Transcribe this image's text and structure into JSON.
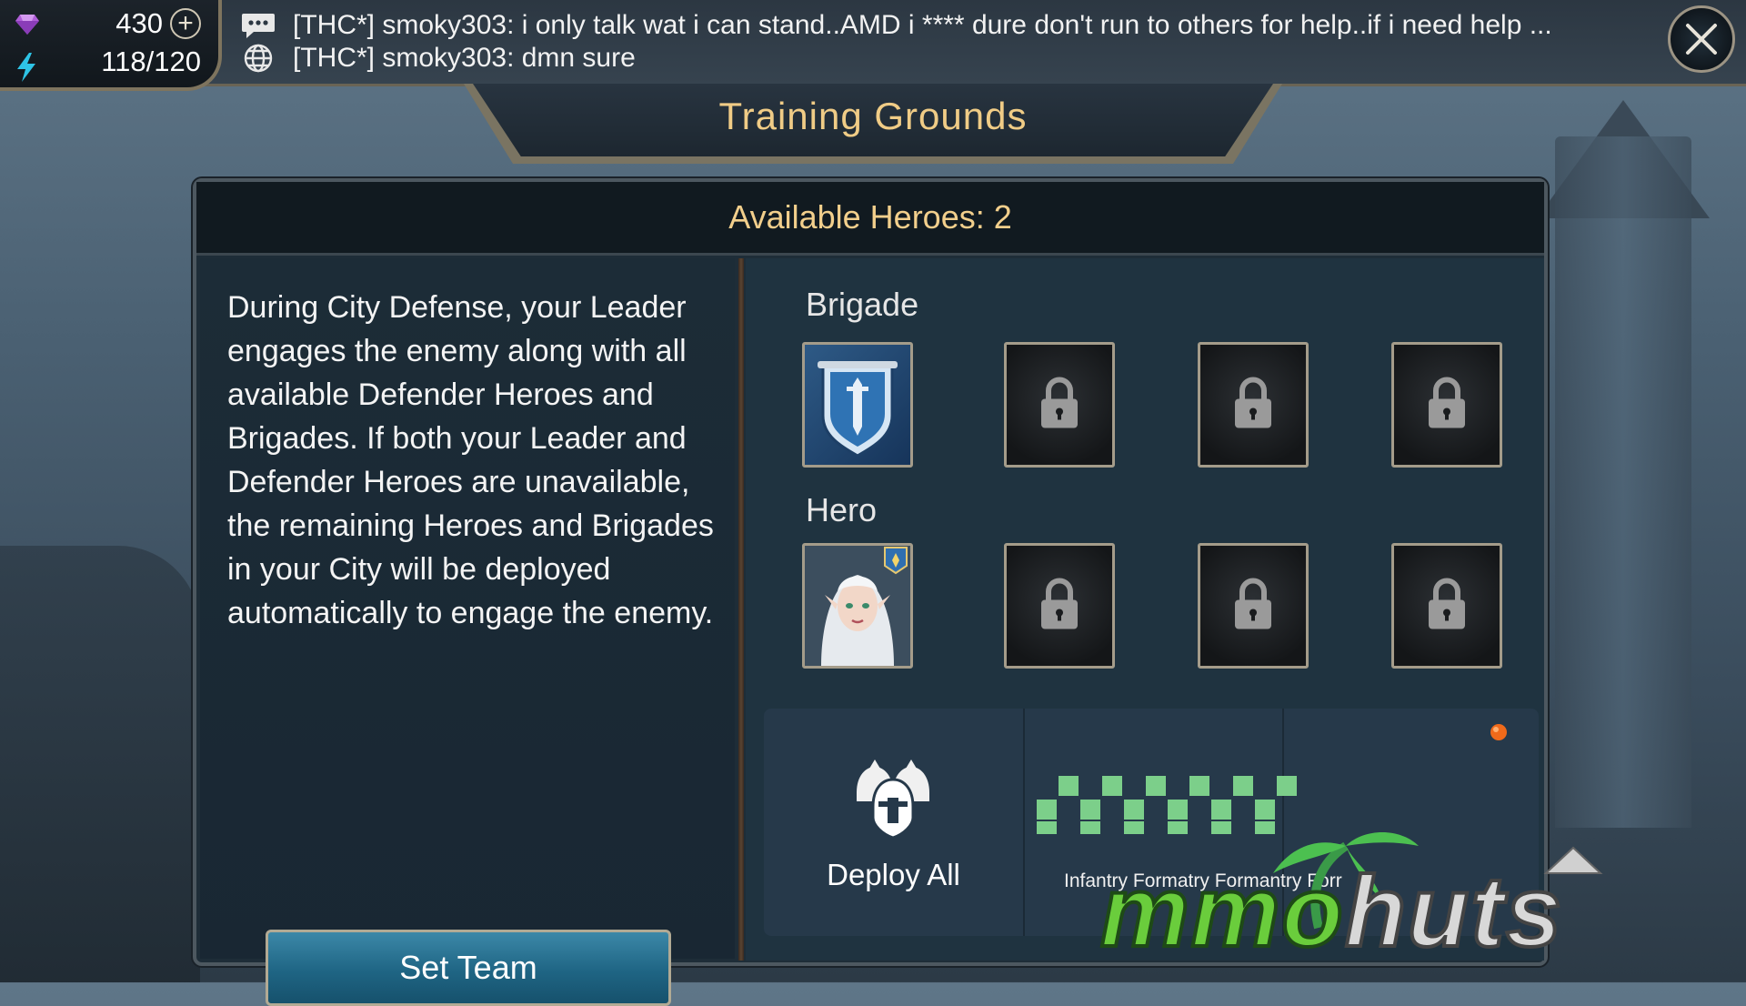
{
  "resources": {
    "gems": "430",
    "energy": "118/120"
  },
  "chat": {
    "messages": [
      {
        "channel_icon": "chat-bubble-icon",
        "text": "[THC*] smoky303: i only talk wat i can stand..AMD i **** dure don't run to others for help..if i need help ..."
      },
      {
        "channel_icon": "globe-icon",
        "text": "[THC*] smoky303: dmn sure"
      }
    ]
  },
  "window": {
    "title": "Training Grounds"
  },
  "panel": {
    "header": "Available Heroes: 2",
    "description": "During City Defense, your Leader engages the enemy along with all available Defender Heroes and Brigades. If both your Leader and Defender Heroes are unavailable, the remaining Heroes and Brigades in your City will be deployed automatically to engage the enemy.",
    "set_team_label": "Set Team",
    "brigade_label": "Brigade",
    "hero_label": "Hero",
    "brigade_slots": [
      "sword-banner-icon",
      "lock-icon",
      "lock-icon",
      "lock-icon"
    ],
    "hero_slots": [
      "hero-portrait",
      "lock-icon",
      "lock-icon",
      "lock-icon"
    ],
    "deploy_all_label": "Deploy All",
    "formation_text": "Infantry Formatry Formantry Forr"
  },
  "watermark": "mmohuts",
  "colors": {
    "title_gold": "#f0cc86",
    "header_gold": "#f2cf8c",
    "button_blue": "#1f6584",
    "formation_green": "#7ccf8a"
  }
}
